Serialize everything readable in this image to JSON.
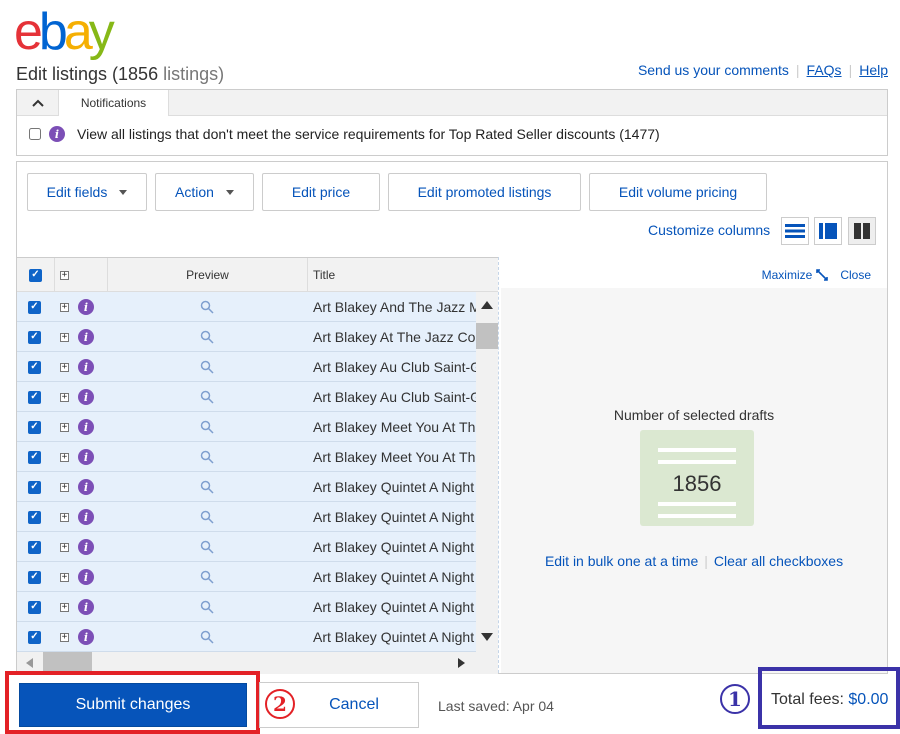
{
  "logo": {
    "letters": [
      "e",
      "b",
      "a",
      "y"
    ]
  },
  "header": {
    "title_prefix": "Edit listings (1856",
    "title_suffix": "listings)",
    "links": [
      "Send us your comments",
      "FAQs",
      "Help"
    ]
  },
  "notifications": {
    "tab_label": "Notifications",
    "message": "View all listings that don't meet the service requirements for Top Rated Seller discounts (1477)"
  },
  "toolbar": {
    "edit_fields": "Edit fields",
    "action": "Action",
    "edit_price": "Edit price",
    "edit_promoted": "Edit promoted listings",
    "edit_volume": "Edit volume pricing",
    "customize_columns": "Customize columns"
  },
  "grid": {
    "columns": [
      "Preview",
      "Title"
    ],
    "rows": [
      "Art Blakey And The Jazz Messengers",
      "Art Blakey At The Jazz Corner",
      "Art Blakey Au Club Saint-Germain",
      "Art Blakey Au Club Saint-Germain",
      "Art Blakey Meet You At The Jazz",
      "Art Blakey Meet You At The Jazz",
      "Art Blakey Quintet A Night At Birdland",
      "Art Blakey Quintet A Night At Birdland",
      "Art Blakey Quintet A Night At Birdland",
      "Art Blakey Quintet A Night At Birdland",
      "Art Blakey Quintet A Night At Birdland",
      "Art Blakey Quintet A Night At Birdland"
    ]
  },
  "side_panel": {
    "maximize": "Maximize",
    "close": "Close",
    "count_label": "Number of selected drafts",
    "count": "1856",
    "edit_bulk": "Edit in bulk one at a time",
    "clear_all": "Clear all checkboxes"
  },
  "footer": {
    "submit": "Submit changes",
    "cancel": "Cancel",
    "last_saved": "Last saved: Apr 04",
    "total_label": "Total fees:",
    "total_value": "$0.00",
    "badge_1": "1",
    "badge_2": "2"
  },
  "colors": {
    "link": "#0654ba",
    "primary_button": "#0654ba",
    "highlight_red": "#e32126",
    "highlight_blue": "#3b32a8",
    "selected_row": "#e6f0fb",
    "info_icon": "#7c4fb6"
  },
  "icons": [
    "chevron-up-icon",
    "info-icon",
    "caret-down-icon",
    "list-view-icon",
    "split-view-icon",
    "columns-view-icon",
    "expand-icon",
    "magnifier-icon",
    "maximize-icon",
    "scroll-up-icon",
    "scroll-down-icon",
    "scroll-left-icon",
    "scroll-right-icon",
    "document-icon"
  ]
}
